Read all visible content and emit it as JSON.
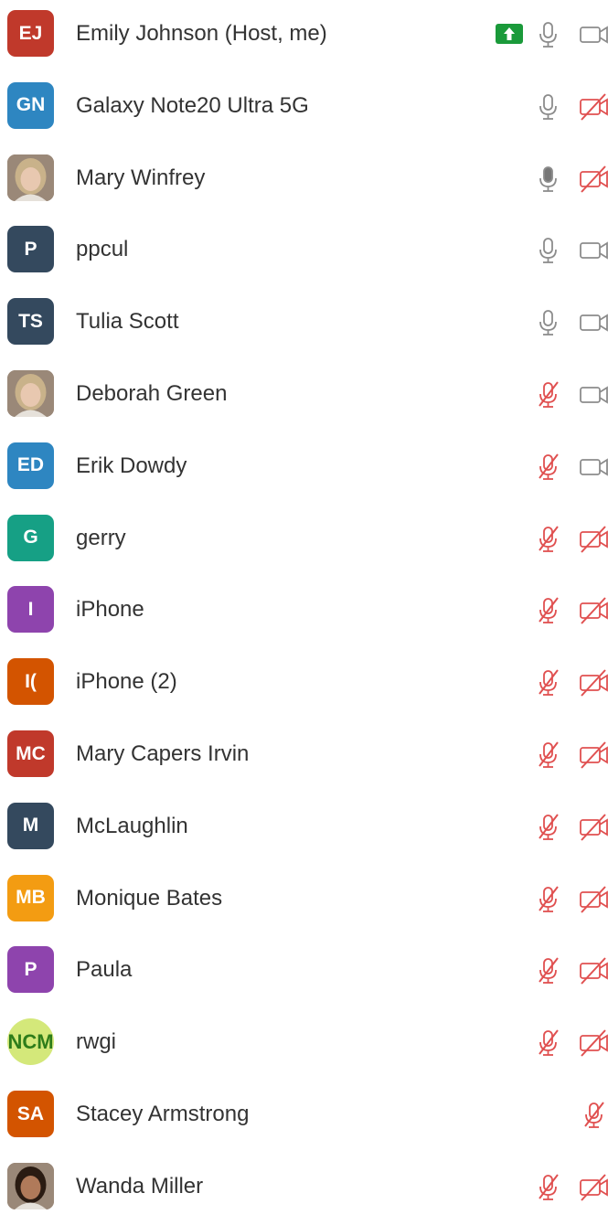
{
  "colors": {
    "muted_red": "#e05050",
    "icon_gray": "#8c8c8c",
    "share_green": "#1a9a3a"
  },
  "participants": [
    {
      "initials": "EJ",
      "name": "Emily Johnson (Host, me)",
      "color": "#c0392b",
      "mic": "on",
      "video": "on",
      "sharing": true
    },
    {
      "initials": "GN",
      "name": "Galaxy Note20 Ultra 5G",
      "color": "#2e86c1",
      "mic": "on",
      "video": "off"
    },
    {
      "initials": "",
      "name": "Mary Winfrey",
      "photo": true,
      "mic": "speaking",
      "video": "off"
    },
    {
      "initials": "P",
      "name": "ppcul",
      "color": "#34495e",
      "mic": "on",
      "video": "on"
    },
    {
      "initials": "TS",
      "name": "Tulia Scott",
      "color": "#34495e",
      "mic": "on",
      "video": "on"
    },
    {
      "initials": "",
      "name": "Deborah Green",
      "photo": true,
      "mic": "off",
      "video": "on"
    },
    {
      "initials": "ED",
      "name": "Erik Dowdy",
      "color": "#2e86c1",
      "mic": "off",
      "video": "on"
    },
    {
      "initials": "G",
      "name": "gerry",
      "color": "#16a085",
      "mic": "off",
      "video": "off"
    },
    {
      "initials": "I",
      "name": "iPhone",
      "color": "#8e44ad",
      "mic": "off",
      "video": "off"
    },
    {
      "initials": "I(",
      "name": "iPhone (2)",
      "color": "#d35400",
      "mic": "off",
      "video": "off"
    },
    {
      "initials": "MC",
      "name": "Mary Capers Irvin",
      "color": "#c0392b",
      "mic": "off",
      "video": "off"
    },
    {
      "initials": "M",
      "name": "McLaughlin",
      "color": "#34495e",
      "mic": "off",
      "video": "off"
    },
    {
      "initials": "MB",
      "name": "Monique Bates",
      "color": "#f39c12",
      "mic": "off",
      "video": "off"
    },
    {
      "initials": "P",
      "name": "Paula",
      "color": "#8e44ad",
      "mic": "off",
      "video": "off"
    },
    {
      "initials": "NCM",
      "name": "rwgi",
      "logo": true,
      "mic": "off",
      "video": "off"
    },
    {
      "initials": "SA",
      "name": "Stacey Armstrong",
      "color": "#d35400",
      "mic": "off",
      "video": "none"
    },
    {
      "initials": "",
      "name": "Wanda Miller",
      "photo": true,
      "mic": "off",
      "video": "off"
    }
  ]
}
